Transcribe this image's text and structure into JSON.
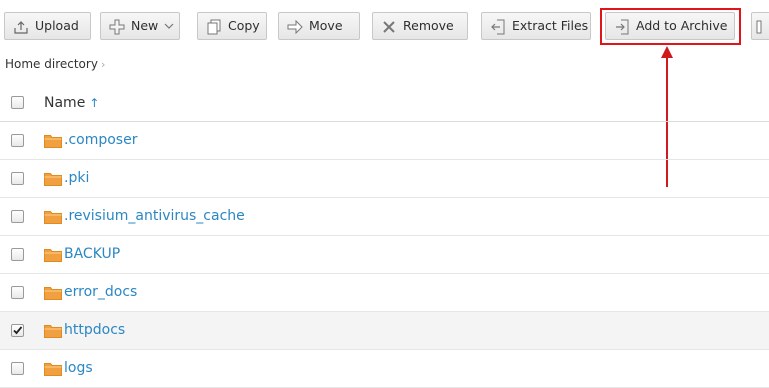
{
  "toolbar": {
    "upload": "Upload",
    "new": "New",
    "copy": "Copy",
    "move": "Move",
    "remove": "Remove",
    "extract": "Extract Files",
    "archive": "Add to Archive"
  },
  "breadcrumb": {
    "home": "Home directory"
  },
  "table": {
    "header": {
      "name": "Name",
      "sort_indicator": "↑"
    },
    "rows": [
      {
        "name": ".composer",
        "checked": false
      },
      {
        "name": ".pki",
        "checked": false
      },
      {
        "name": ".revisium_antivirus_cache",
        "checked": false
      },
      {
        "name": "BACKUP",
        "checked": false
      },
      {
        "name": "error_docs",
        "checked": false
      },
      {
        "name": "httpdocs",
        "checked": true
      },
      {
        "name": "logs",
        "checked": false
      }
    ]
  },
  "colors": {
    "link": "#2b87c4",
    "folder": "#f0a040",
    "highlight": "#e0141a"
  }
}
